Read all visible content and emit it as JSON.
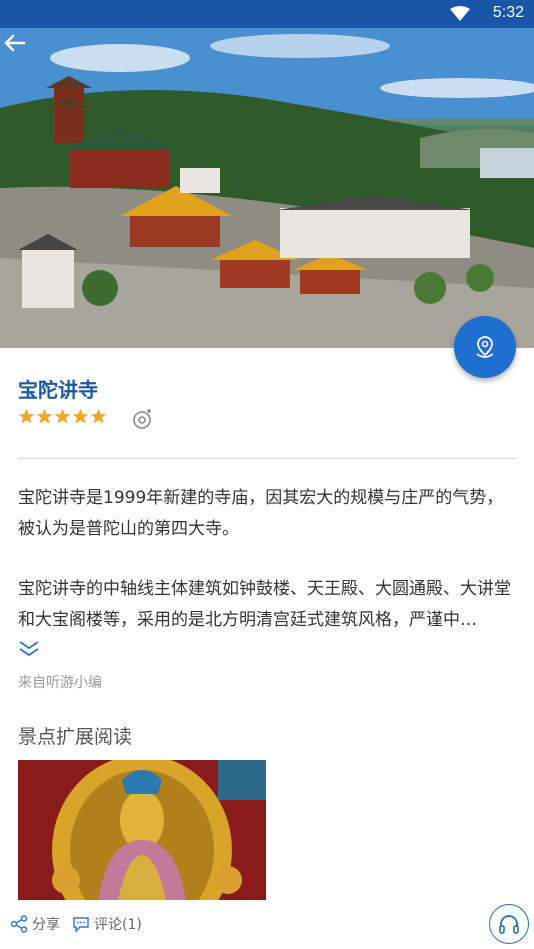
{
  "statusbar": {
    "time": "5:32",
    "wifi_icon": "wifi-icon"
  },
  "hero": {
    "back_icon": "arrow-left-icon",
    "location_icon": "map-pin-icon"
  },
  "title": "宝陀讲寺",
  "rating": {
    "stars": 5,
    "max": 5,
    "color": "#f5a623"
  },
  "description": {
    "paragraph1": "宝陀讲寺是1999年新建的寺庙，因其宏大的规模与庄严的气势，被认为是普陀山的第四大寺。",
    "paragraph2": "宝陀讲寺的中轴线主体建筑如钟鼓楼、天王殿、大圆通殿、大讲堂和大宝阁楼等，采用的是北方明清宫廷式建筑风格，严谨中…"
  },
  "source_text": "来自听游小编",
  "extended_reading": {
    "title": "景点扩展阅读"
  },
  "bottom": {
    "share_label": "分享",
    "comment_label": "评论(1)"
  },
  "colors": {
    "brand": "#1a56a8",
    "accent": "#1f6fd0"
  }
}
